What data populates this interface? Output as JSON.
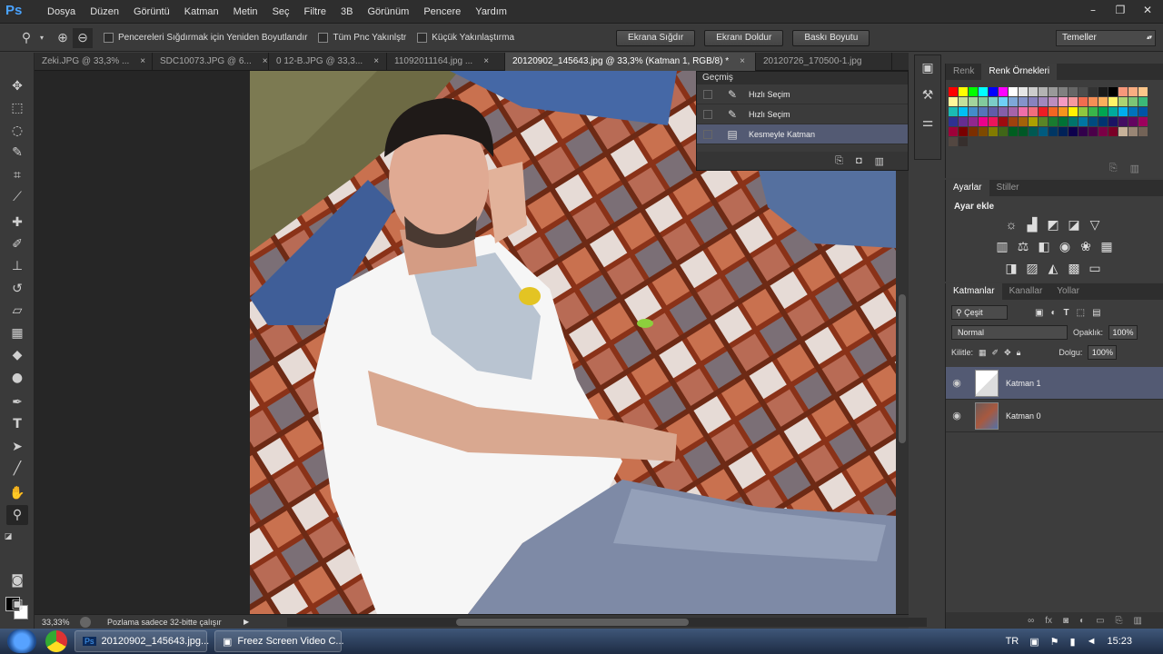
{
  "menubar": {
    "logo": "Ps",
    "items": [
      "Dosya",
      "Düzen",
      "Görüntü",
      "Katman",
      "Metin",
      "Seç",
      "Filtre",
      "3B",
      "Görünüm",
      "Pencere",
      "Yardım"
    ]
  },
  "options": {
    "check1": "Pencereleri Sığdırmak için Yeniden Boyutlandır",
    "check2": "Tüm Pnc Yakınlştr",
    "check3": "Küçük Yakınlaştırma",
    "btn_fit": "Ekrana Sığdır",
    "btn_fill": "Ekranı Doldur",
    "btn_print": "Baskı Boyutu",
    "workspace": "Temeller"
  },
  "tabs": [
    {
      "label": "Zeki.JPG @ 33,3% ..."
    },
    {
      "label": "SDC10073.JPG @ 6..."
    },
    {
      "label": "0 12-B.JPG @ 33,3..."
    },
    {
      "label": "11092011164.jpg ..."
    },
    {
      "label": "20120902_145643.jpg @ 33,3% (Katman 1, RGB/8) *"
    },
    {
      "label": "20120726_170500-1.jpg"
    }
  ],
  "history": {
    "title": "Geçmiş",
    "rows": [
      "Hızlı Seçim",
      "Hızlı Seçim",
      "Kesmeyle Katman"
    ]
  },
  "swatches": {
    "tab1": "Renk",
    "tab2": "Renk Örnekleri"
  },
  "adjustments": {
    "tab1": "Ayarlar",
    "tab2": "Stiller",
    "title": "Ayar ekle"
  },
  "layers": {
    "tab1": "Katmanlar",
    "tab2": "Kanallar",
    "tab3": "Yollar",
    "kind": "Çeşit",
    "blend_mode": "Normal",
    "opacity_label": "Opaklık:",
    "opacity": "100%",
    "lock_label": "Kilitle:",
    "fill_label": "Dolgu:",
    "fill": "100%",
    "items": [
      {
        "name": "Katman 1"
      },
      {
        "name": "Katman 0"
      }
    ]
  },
  "status": {
    "zoom": "33,33%",
    "info": "Pozlama sadece 32-bitte çalışır"
  },
  "taskbar": {
    "task1": "20120902_145643.jpg...",
    "task2": "Freez Screen Video C...",
    "lang": "TR",
    "time": "15:23"
  }
}
